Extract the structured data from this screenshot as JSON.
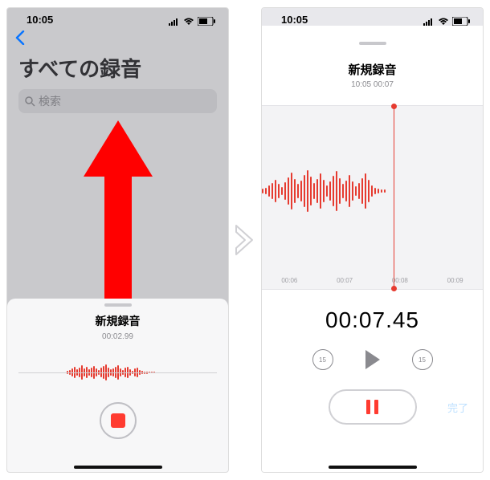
{
  "status_time": "10:05",
  "left": {
    "page_title": "すべての録音",
    "search_placeholder": "検索",
    "recording_title": "新規録音",
    "recording_elapsed": "00:02.99"
  },
  "right": {
    "recording_title": "新規録音",
    "subtitle": "10:05  00:07",
    "timemarks": [
      "00:06",
      "00:07",
      "00:08",
      "00:09"
    ],
    "big_time": "00:07.45",
    "skip_amount": "15",
    "done_label": "完了"
  }
}
